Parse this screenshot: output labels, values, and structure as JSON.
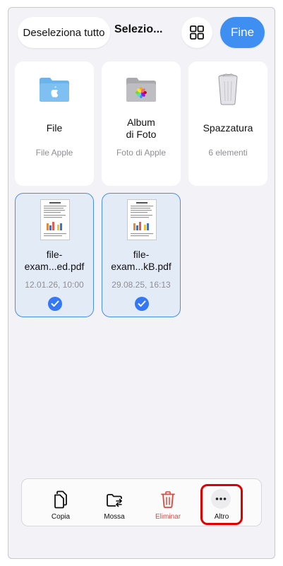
{
  "header": {
    "deselect_label": "Deseleziona tutto",
    "title": "Selezio...",
    "view_icon": "grid-icon",
    "done_label": "Fine"
  },
  "tiles": [
    {
      "name": "File",
      "subtitle": "File Apple",
      "icon": "apple-folder-icon",
      "selected": false
    },
    {
      "name": "Album\ndi Foto",
      "subtitle": "Foto di Apple",
      "icon": "photos-folder-icon",
      "selected": false
    },
    {
      "name": "Spazzatura",
      "subtitle": "6 elementi",
      "icon": "trash-bin-icon",
      "selected": false
    },
    {
      "name": "file-\nexam...ed.pdf",
      "subtitle": "12.01.26, 10:00",
      "icon": "pdf-thumbnail-icon",
      "selected": true
    },
    {
      "name": "file-\nexam...kB.pdf",
      "subtitle": "29.08.25, 16:13",
      "icon": "pdf-thumbnail-icon",
      "selected": true
    }
  ],
  "toolbar": {
    "copy_label": "Copia",
    "move_label": "Mossa",
    "delete_label": "Eliminar",
    "more_label": "Altro"
  },
  "colors": {
    "accent": "#3f8ef1",
    "selection": "#3478f6",
    "delete": "#e3453b",
    "highlight": "#e00000"
  }
}
